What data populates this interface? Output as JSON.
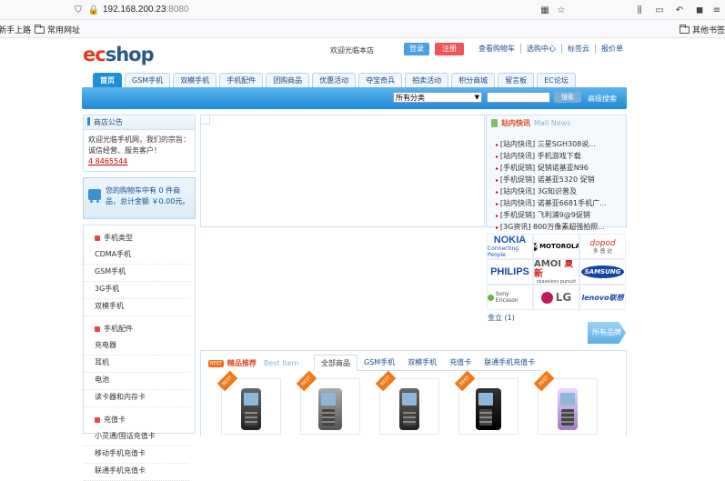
{
  "browser": {
    "url_host": "192.168.200.23",
    "url_port": ":8080",
    "bookmarks": [
      "新手上路",
      "常用网址"
    ],
    "other_bookmarks": "其他书签"
  },
  "header": {
    "welcome": "欢迎光临本店",
    "login": "登录",
    "register": "注册",
    "links": [
      "查看购物车",
      "选购中心",
      "标签云",
      "报价单"
    ]
  },
  "nav": {
    "tabs": [
      "首页",
      "GSM手机",
      "双模手机",
      "手机配件",
      "团购商品",
      "优惠活动",
      "夺宝奇兵",
      "拍卖活动",
      "积分商城",
      "留言板",
      "EC论坛"
    ]
  },
  "search": {
    "category": "所有分类",
    "button": "搜索",
    "advanced": "高级搜索"
  },
  "notice": {
    "title": "商店公告",
    "body": "欢迎光临手机网，我们的宗旨：诚信经营、服务客户！",
    "phone": "4 8465544"
  },
  "cart": {
    "text": "您的购物车中有 0 件商品，总计金额 ￥0.00元。"
  },
  "categories": [
    {
      "title": "手机类型",
      "items": [
        "CDMA手机",
        "GSM手机",
        "3G手机",
        "双模手机"
      ]
    },
    {
      "title": "手机配件",
      "items": [
        "充电器",
        "耳机",
        "电池",
        "读卡器和内存卡"
      ]
    },
    {
      "title": "充值卡",
      "items": [
        "小灵通/固话充值卡",
        "移动手机充值卡",
        "联通手机充值卡"
      ]
    }
  ],
  "news": {
    "title_cn": "站内快讯",
    "title_en": "Mall News",
    "items": [
      "[站内快讯] 三星SGH308说...",
      "[站内快讯] 手机游戏下载",
      "[手机促销] 促销诺基亚N96",
      "[手机促销] 诺基亚5320 促销",
      "[站内快讯] 3G知识普及",
      "[站内快讯] 诺基亚6681手机广...",
      "[手机促销] 飞利浦9@9促销",
      "[3G资讯] 800万像素超强拍照..."
    ]
  },
  "brands": {
    "nokia": [
      "NOKIA",
      "Connecting People"
    ],
    "motorola": [
      "M",
      "MOTOROLA"
    ],
    "dopod": [
      "dopod",
      "多 普 达"
    ],
    "philips": "PHILIPS",
    "amoi": [
      "AMOI",
      "夏新",
      "ceaseless pursuit"
    ],
    "samsung": "SAMSUNG",
    "sony": "Sony Ericsson",
    "lg": "LG",
    "lenovo": "lenovo联想",
    "more": "金立 (1)",
    "all": "所有品牌"
  },
  "best": {
    "tag": "BEST",
    "title_cn": "精品推荐",
    "title_en": "Best Item",
    "tabs": [
      "全部商品",
      "GSM手机",
      "双模手机",
      "充值卡",
      "联通手机充值卡"
    ],
    "ribbon": "BEST"
  },
  "colors": {
    "accent": "#1f8fd8",
    "brand_red": "#e23b1c",
    "link": "#1a4b8c"
  }
}
